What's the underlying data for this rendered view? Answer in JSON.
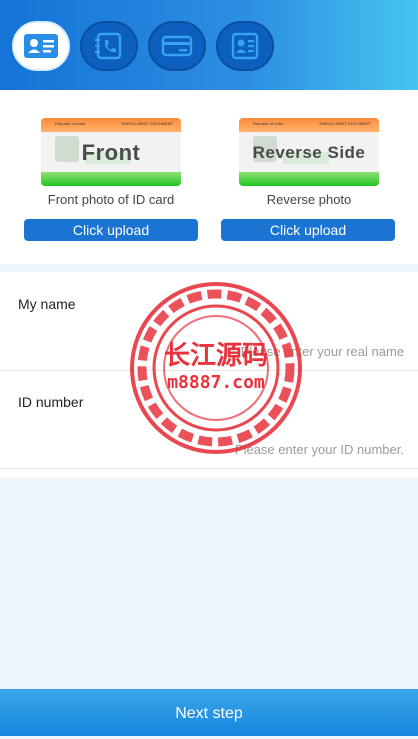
{
  "steps": [
    {
      "icon": "id-card-icon",
      "active": true
    },
    {
      "icon": "phone-book-icon",
      "active": false
    },
    {
      "icon": "bank-card-icon",
      "active": false
    },
    {
      "icon": "profile-doc-icon",
      "active": false
    }
  ],
  "upload": {
    "front": {
      "card_text": "Front",
      "card_header_left": "Republic of India",
      "card_header_right": "ENROLLMENT DOCUMENT",
      "caption": "Front photo of ID card",
      "button": "Click upload"
    },
    "back": {
      "card_text": "Reverse Side",
      "card_header_left": "Republic of India",
      "card_header_right": "ENROLLMENT DOCUMENT",
      "caption": "Reverse photo",
      "button": "Click upload"
    }
  },
  "form": {
    "name": {
      "label": "My name",
      "placeholder": "Please enter your real name"
    },
    "id": {
      "label": "ID number",
      "placeholder": "Please enter your ID number."
    }
  },
  "watermark": {
    "line1": "长江源码",
    "line2": "m8887.com",
    "color": "#e8323c"
  },
  "footer": {
    "next": "Next step"
  },
  "colors": {
    "primary": "#1b74d2",
    "header_start": "#1473d6",
    "header_end": "#46c4ef"
  }
}
